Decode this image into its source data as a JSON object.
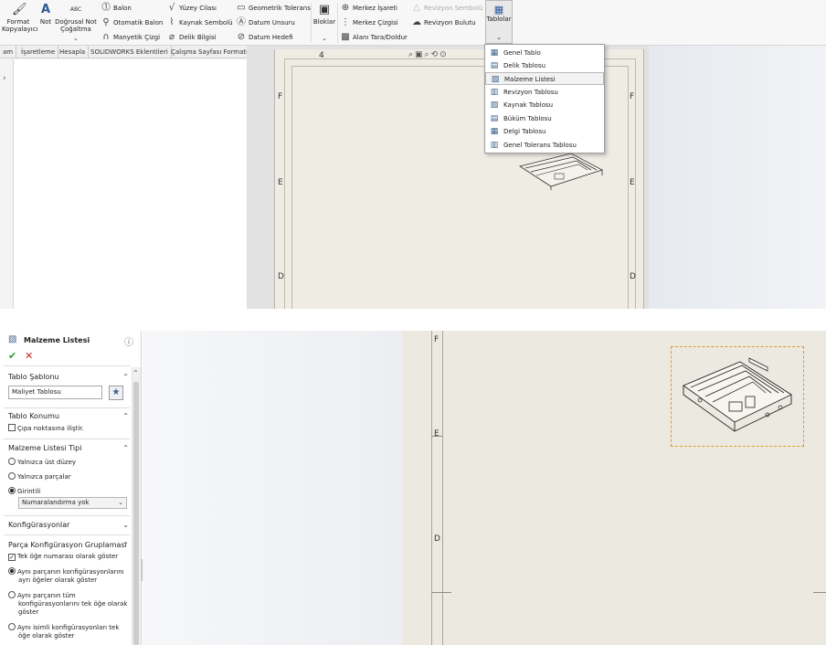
{
  "ribbon": {
    "format_painter": "Format Kopyalayıcı",
    "note": "Not",
    "linear_note": "Doğrusal Not Çoğaltma",
    "balloon": "Balon",
    "auto_balloon": "Otomatik Balon",
    "magnetic_line": "Manyetik Çizgi",
    "surface_finish": "Yüzey Cilası",
    "weld_symbol": "Kaynak Sembolü",
    "hole_callout": "Delik Bilgisi",
    "geo_tolerance": "Geometrik Tolerans",
    "datum_feature": "Datum Unsuru",
    "datum_target": "Datum Hedefi",
    "blocks": "Bloklar",
    "center_mark": "Merkez İşareti",
    "centerline": "Merkez Çizgisi",
    "area_hatch": "Alanı Tara/Doldur",
    "revision_symbol": "Revizyon Sembolü",
    "revision_cloud": "Revizyon Bulutu",
    "tables": "Tablolar",
    "abc": "ABC"
  },
  "tabs": [
    "am",
    "İşaretleme",
    "Hesapla",
    "SOLIDWORKS Eklentileri",
    "Çalışma Sayfası Formatı"
  ],
  "sheet_top": {
    "zone_top": "4",
    "zones": [
      "F",
      "E",
      "D"
    ]
  },
  "dropdown": {
    "items": [
      {
        "label": "Genel Tablo",
        "icon": "table-icon"
      },
      {
        "label": "Delik Tablosu",
        "icon": "hole-table-icon"
      },
      {
        "label": "Malzeme Listesi",
        "icon": "bom-icon"
      },
      {
        "label": "Revizyon Tablosu",
        "icon": "revision-table-icon"
      },
      {
        "label": "Kaynak Tablosu",
        "icon": "weld-table-icon"
      },
      {
        "label": "Büküm Tablosu",
        "icon": "bend-table-icon"
      },
      {
        "label": "Delgi Tablosu",
        "icon": "punch-table-icon"
      },
      {
        "label": "Genel Tolerans Tablosu",
        "icon": "tolerance-table-icon"
      }
    ],
    "selected_index": 2
  },
  "property_manager": {
    "title": "Malzeme Listesi",
    "template_section": "Tablo Şablonu",
    "template_value": "Maliyet Tablosu",
    "position_section": "Tablo Konumu",
    "anchor_option": "Çıpa noktasına iliştir.",
    "type_section": "Malzeme Listesi Tipi",
    "type_options": [
      "Yalnızca üst düzey",
      "Yalnızca parçalar",
      "Girintili"
    ],
    "type_selected": 2,
    "numbering_value": "Numaralandırma yok",
    "config_section": "Konfigürasyonlar",
    "grouping_section": "Parça Konfigürasyon Gruplaması",
    "grouping_check": "Tek öğe numarası olarak göster",
    "grouping_options": [
      "Aynı parçanın konfigürasyonlarını ayrı öğeler olarak göster",
      "Aynı parçanın tüm konfigürasyonlarını tek öğe olarak göster",
      "Aynı isimli konfigürasyonları tek öğe olarak göster"
    ]
  },
  "sheet_bottom": {
    "zones": [
      "F",
      "E",
      "D"
    ]
  }
}
